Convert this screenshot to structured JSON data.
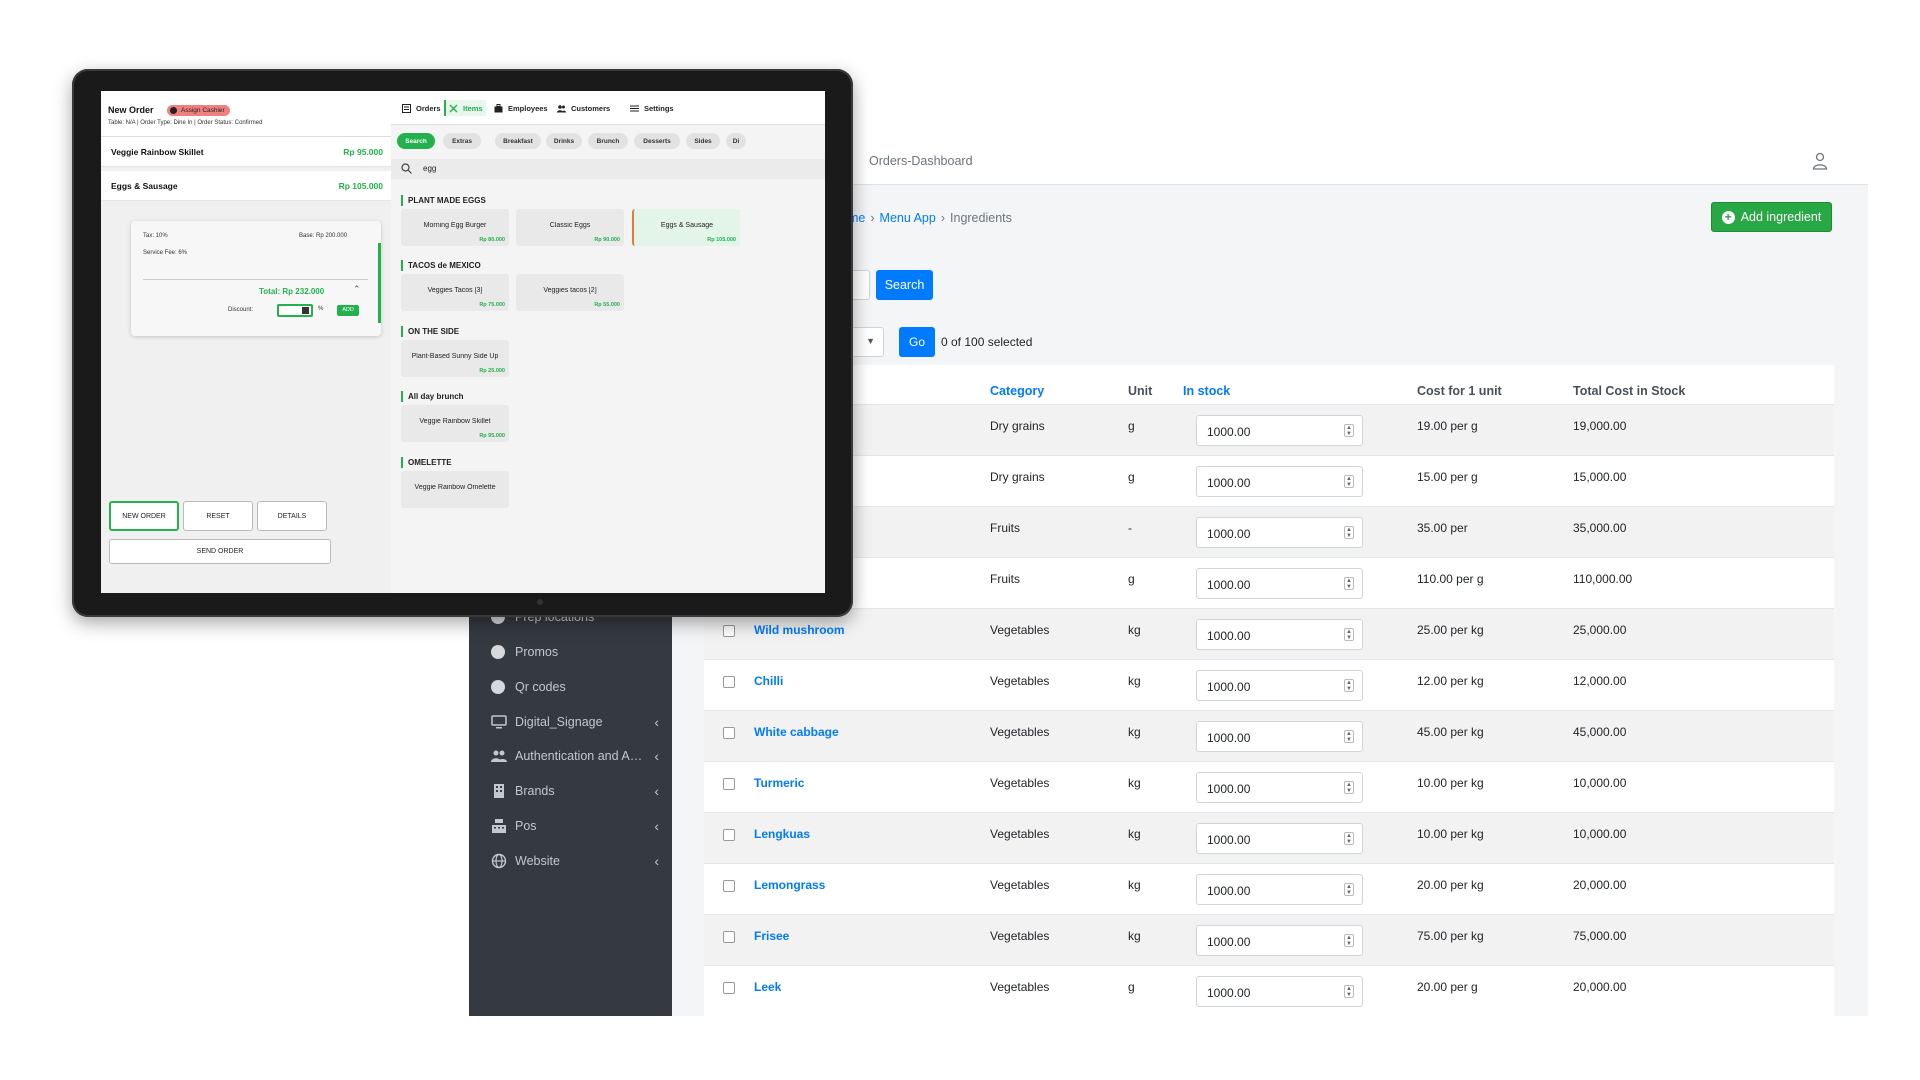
{
  "admin": {
    "topbar_title": "Orders-Dashboard",
    "breadcrumb": [
      "me",
      "Menu App",
      "Ingredients"
    ],
    "add_button": "Add ingredient",
    "search_button": "Search",
    "go_button": "Go",
    "selected_count": "0 of 100 selected",
    "sidebar": [
      {
        "label": "Prep locations",
        "icon": "circle-icon",
        "chevron": false
      },
      {
        "label": "Promos",
        "icon": "circle-icon",
        "chevron": false
      },
      {
        "label": "Qr codes",
        "icon": "circle-icon",
        "chevron": false
      },
      {
        "label": "Digital_Signage",
        "icon": "monitor-icon",
        "chevron": true
      },
      {
        "label": "Authentication and Authorization",
        "icon": "users-icon",
        "chevron": true
      },
      {
        "label": "Brands",
        "icon": "building-icon",
        "chevron": true
      },
      {
        "label": "Pos",
        "icon": "cash-register-icon",
        "chevron": true
      },
      {
        "label": "Website",
        "icon": "globe-icon",
        "chevron": true
      }
    ],
    "table": {
      "headers": [
        "Category",
        "Unit",
        "In stock",
        "Cost for 1 unit",
        "Total Cost in Stock"
      ],
      "rows": [
        {
          "name": "",
          "category": "Dry grains",
          "unit": "g",
          "stock": "1000.00",
          "cost": "19.00 per g",
          "total": "19,000.00"
        },
        {
          "name": "",
          "category": "Dry grains",
          "unit": "g",
          "stock": "1000.00",
          "cost": "15.00 per g",
          "total": "15,000.00"
        },
        {
          "name": "",
          "category": "Fruits",
          "unit": "-",
          "stock": "1000.00",
          "cost": "35.00 per",
          "total": "35,000.00"
        },
        {
          "name": "",
          "category": "Fruits",
          "unit": "g",
          "stock": "1000.00",
          "cost": "110.00 per g",
          "total": "110,000.00"
        },
        {
          "name": "Wild mushroom",
          "category": "Vegetables",
          "unit": "kg",
          "stock": "1000.00",
          "cost": "25.00 per kg",
          "total": "25,000.00"
        },
        {
          "name": "Chilli",
          "category": "Vegetables",
          "unit": "kg",
          "stock": "1000.00",
          "cost": "12.00 per kg",
          "total": "12,000.00"
        },
        {
          "name": "White cabbage",
          "category": "Vegetables",
          "unit": "kg",
          "stock": "1000.00",
          "cost": "45.00 per kg",
          "total": "45,000.00"
        },
        {
          "name": "Turmeric",
          "category": "Vegetables",
          "unit": "kg",
          "stock": "1000.00",
          "cost": "10.00 per kg",
          "total": "10,000.00"
        },
        {
          "name": "Lengkuas",
          "category": "Vegetables",
          "unit": "kg",
          "stock": "1000.00",
          "cost": "10.00 per kg",
          "total": "10,000.00"
        },
        {
          "name": "Lemongrass",
          "category": "Vegetables",
          "unit": "kg",
          "stock": "1000.00",
          "cost": "20.00 per kg",
          "total": "20,000.00"
        },
        {
          "name": "Frisee",
          "category": "Vegetables",
          "unit": "kg",
          "stock": "1000.00",
          "cost": "75.00 per kg",
          "total": "75,000.00"
        },
        {
          "name": "Leek",
          "category": "Vegetables",
          "unit": "g",
          "stock": "1000.00",
          "cost": "20.00 per g",
          "total": "20,000.00"
        }
      ]
    }
  },
  "pos": {
    "order_title": "New Order",
    "assign_badge": "Assign Cashier",
    "order_meta": "Table: N/A | Order Type: Dine In | Order Status: Confirmed",
    "lines": [
      {
        "name": "Veggie Rainbow Skillet",
        "price": "Rp 95.000"
      },
      {
        "name": "Eggs & Sausage",
        "price": "Rp 105.000"
      }
    ],
    "summary": {
      "tax": "Tax: 10%",
      "base": "Base: Rp 200.000",
      "service_fee": "Service Fee: 6%",
      "total": "Total: Rp 232.000",
      "discount_label": "Discount:",
      "percent": "%",
      "add": "ADD"
    },
    "buttons": {
      "new_order": "NEW ORDER",
      "reset": "RESET",
      "details": "DETAILS",
      "send_order": "SEND ORDER"
    },
    "nav": [
      "Orders",
      "Items",
      "Employees",
      "Customers",
      "Settings"
    ],
    "categories": [
      "Search",
      "Extras",
      "Breakfast",
      "Drinks",
      "Brunch",
      "Desserts",
      "Sides",
      "Di"
    ],
    "search_query": "egg",
    "sections": [
      {
        "title": "PLANT MADE EGGS",
        "items": [
          {
            "name": "Morning Egg Burger",
            "price": "Rp 80.000"
          },
          {
            "name": "Classic Eggs",
            "price": "Rp 90.000"
          },
          {
            "name": "Eggs & Sausage",
            "price": "Rp 105.000"
          }
        ]
      },
      {
        "title": "TACOS de MEXICO",
        "items": [
          {
            "name": "Veggies Tacos [3]",
            "price": "Rp 75.000"
          },
          {
            "name": "Veggies tacos [2]",
            "price": "Rp 55.000"
          }
        ]
      },
      {
        "title": "ON THE SIDE",
        "items": [
          {
            "name": "Plant-Based Sunny Side Up",
            "price": "Rp 25.000"
          }
        ]
      },
      {
        "title": "All day brunch",
        "items": [
          {
            "name": "Veggie Rainbow Skillet",
            "price": "Rp 95.000"
          }
        ]
      },
      {
        "title": "OMELETTE",
        "items": [
          {
            "name": "Veggie Rainbow Omelette",
            "price": ""
          }
        ]
      }
    ]
  }
}
